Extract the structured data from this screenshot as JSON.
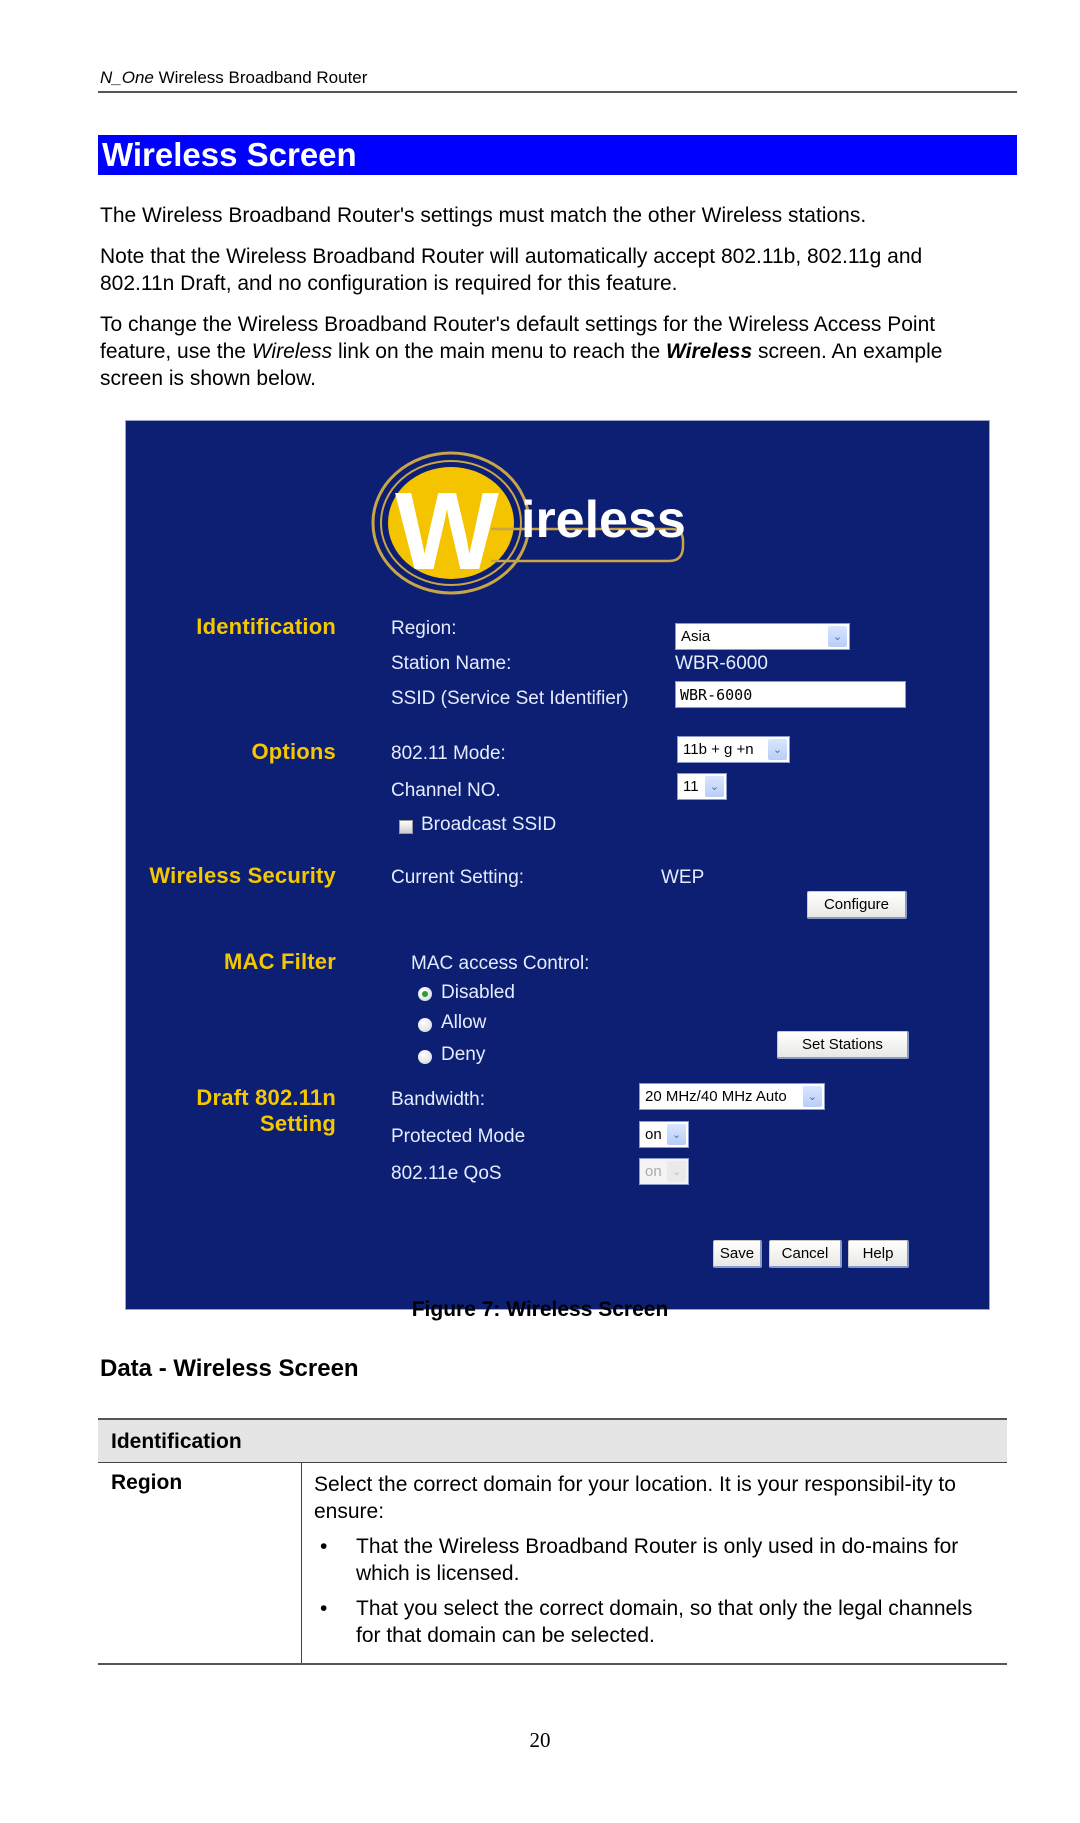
{
  "running_head": {
    "product_italic": "N_One",
    "rest": " Wireless Broadband Router"
  },
  "section_title": "Wireless Screen",
  "paragraphs": {
    "p1": "The Wireless Broadband Router's settings must match the other Wireless stations.",
    "p2": "Note that the Wireless Broadband Router will automatically accept 802.11b, 802.11g and 802.11n Draft, and no configuration is required for this feature.",
    "p3_a": "To change the Wireless Broadband Router's default settings for the Wireless Access Point feature, use the ",
    "p3_italic": "Wireless",
    "p3_b": " link on the main menu to reach the ",
    "p3_bold_italic": "Wireless",
    "p3_c": " screen. An example screen is shown below."
  },
  "screen": {
    "logo": {
      "big_letter": "W",
      "rest": "ireless"
    },
    "colors": {
      "panel_bg": "#0c1f72",
      "section_label": "#f5c700",
      "field_text": "#e6ecff"
    },
    "identification": {
      "label": "Identification",
      "region_label": "Region:",
      "region_value": "Asia",
      "station_name_label": "Station Name:",
      "station_name_value": "WBR-6000",
      "ssid_label": "SSID (Service Set Identifier)",
      "ssid_value": "WBR-6000"
    },
    "options": {
      "label": "Options",
      "mode_label": "802.11 Mode:",
      "mode_value": "11b + g +n",
      "channel_label": "Channel NO.",
      "channel_value": "11",
      "broadcast_ssid_label": "Broadcast SSID",
      "broadcast_ssid_checked": false
    },
    "security": {
      "label": "Wireless Security",
      "current_label": "Current Setting:",
      "current_value": "WEP",
      "configure_button": "Configure"
    },
    "mac_filter": {
      "label": "MAC Filter",
      "control_label": "MAC access Control:",
      "options": [
        "Disabled",
        "Allow",
        "Deny"
      ],
      "selected": "Disabled",
      "set_stations_button": "Set Stations"
    },
    "draft_n": {
      "label_line1": "Draft 802.11n",
      "label_line2": "Setting",
      "bandwidth_label": "Bandwidth:",
      "bandwidth_value": "20 MHz/40 MHz Auto",
      "protected_label": "Protected Mode",
      "protected_value": "on",
      "qos_label": "802.11e QoS",
      "qos_value": "on"
    },
    "buttons": {
      "save": "Save",
      "cancel": "Cancel",
      "help": "Help"
    }
  },
  "figure_caption": "Figure 7: Wireless Screen",
  "data_heading": "Data - Wireless Screen",
  "table": {
    "header": "Identification",
    "rows": [
      {
        "field": "Region",
        "description": "Select the correct domain for your location. It is your responsibil-ity to ensure:",
        "bullets": [
          "That the Wireless Broadband Router is only used in do-mains for which is licensed.",
          "That you select the correct domain, so that only the legal channels for that domain can be selected."
        ]
      }
    ]
  },
  "page_number": "20"
}
